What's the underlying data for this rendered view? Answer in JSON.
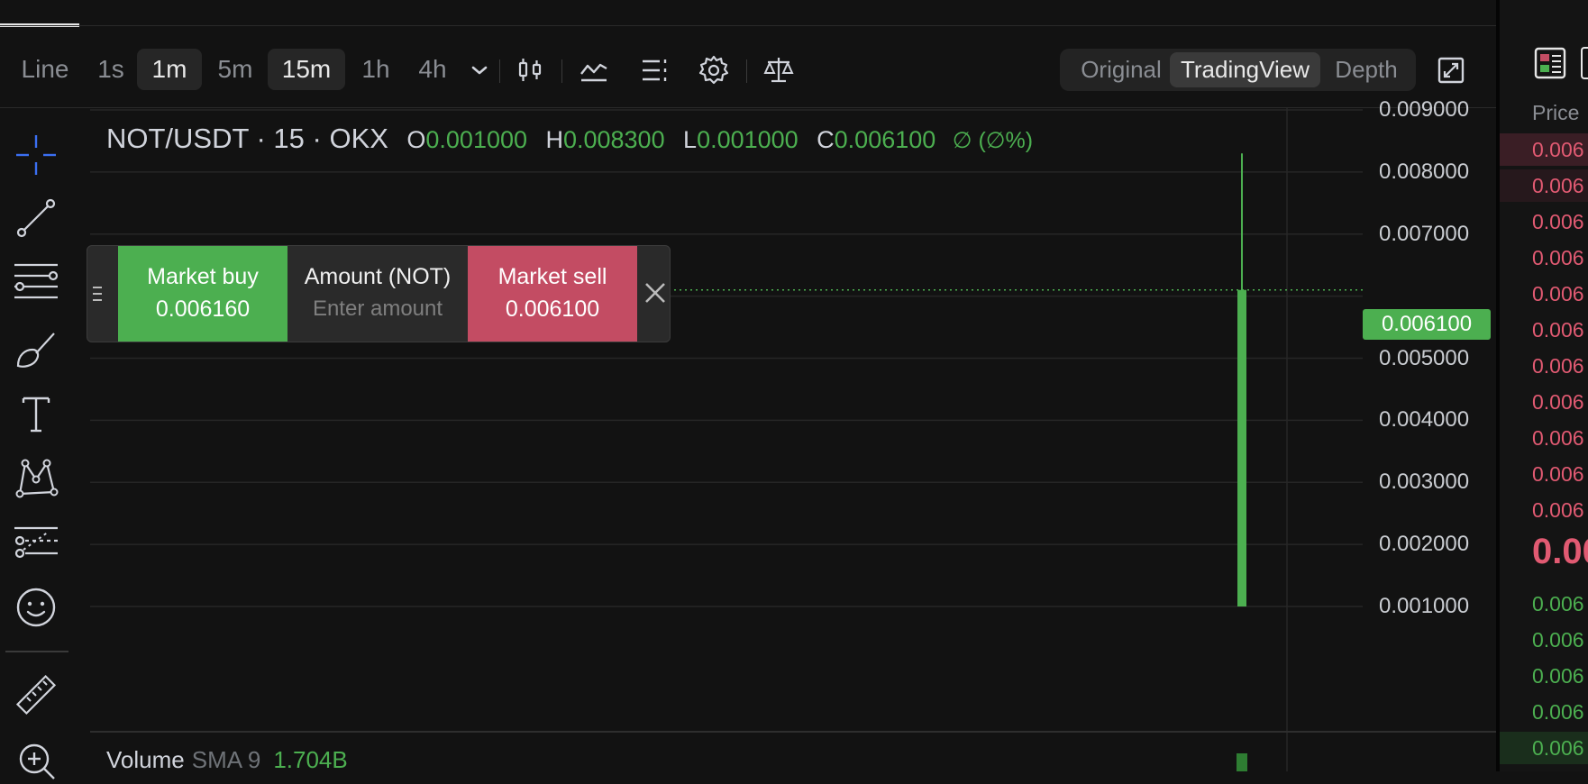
{
  "toolbar": {
    "chart_type": "Line",
    "timeframes": [
      "1s",
      "1m",
      "5m",
      "15m",
      "1h",
      "4h"
    ],
    "active_timeframes": [
      "1m",
      "15m"
    ],
    "views": [
      "Original",
      "TradingView",
      "Depth"
    ],
    "active_view": "TradingView",
    "icons": [
      "chevron-down-icon",
      "candlestick-icon",
      "indicator-icon",
      "layout-list-icon",
      "gear-icon",
      "scale-icon",
      "expand-icon"
    ]
  },
  "left_tools": [
    "crosshair-icon",
    "trend-line-icon",
    "fib-lines-icon",
    "brush-icon",
    "text-icon",
    "pattern-icon",
    "forecast-icon",
    "emoji-icon",
    "ruler-icon",
    "zoom-in-icon"
  ],
  "legend": {
    "symbol": "NOT/USDT · 15 · OKX",
    "o_label": "O",
    "o_value": "0.001000",
    "h_label": "H",
    "h_value": "0.008300",
    "l_label": "L",
    "l_value": "0.001000",
    "c_label": "C",
    "c_value": "0.006100",
    "change": "∅ (∅%)"
  },
  "order_panel": {
    "buy_label": "Market buy",
    "buy_price": "0.006160",
    "amount_label": "Amount (NOT)",
    "amount_placeholder": "Enter amount",
    "sell_label": "Market sell",
    "sell_price": "0.006100"
  },
  "price_scale": {
    "ticks": [
      "0.009000",
      "0.008000",
      "0.007000",
      "0.005000",
      "0.004000",
      "0.003000",
      "0.002000",
      "0.001000"
    ],
    "current_price": "0.006100"
  },
  "volume": {
    "label": "Volume",
    "sma": "SMA 9",
    "value": "1.704B"
  },
  "chart_data": {
    "type": "candlestick",
    "ylim": [
      0.001,
      0.009
    ],
    "candles": [
      {
        "open": 0.001,
        "high": 0.0083,
        "low": 0.001,
        "close": 0.0061
      }
    ],
    "colors": {
      "up": "#4caf50",
      "down": "#c34c63",
      "grid": "#262626"
    }
  },
  "order_book": {
    "header": "Price",
    "asks": [
      "0.006",
      "0.006",
      "0.006",
      "0.006",
      "0.006",
      "0.006",
      "0.006",
      "0.006",
      "0.006",
      "0.006",
      "0.006"
    ],
    "mid": "0.00",
    "bids": [
      "0.006",
      "0.006",
      "0.006",
      "0.006",
      "0.006"
    ]
  }
}
